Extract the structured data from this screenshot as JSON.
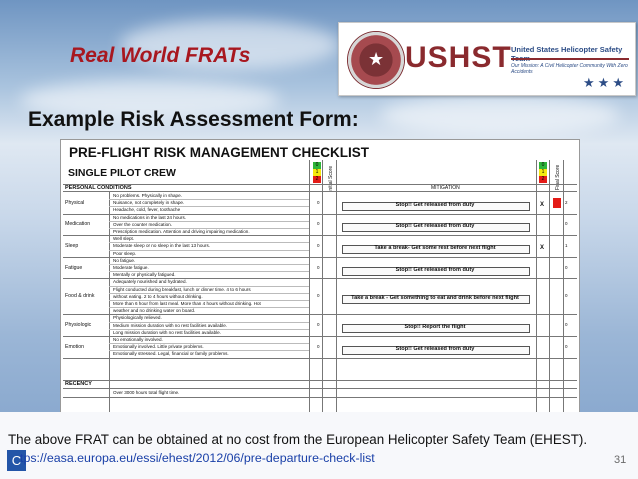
{
  "slide": {
    "title": "Real World FRATs",
    "heading": "Example Risk Assessment Form:",
    "page_number": "31",
    "corner_badge": "C"
  },
  "logo": {
    "wordmark": "USHST",
    "name": "United States Helicopter Safety Team",
    "tagline": "Our Mission: A Civil Helicopter Community With Zero Accidents",
    "seal_text": "USHST United States Helicopter Safety Team"
  },
  "form": {
    "title": "PRE-FLIGHT RISK MANAGEMENT CHECKLIST",
    "crew_label": "SINGLE PILOT CREW",
    "initial_score_label": "Initial Score",
    "final_score_label": "Final Score",
    "mitigation_header": "MITIGATION",
    "score_key": [
      "0",
      "1",
      "2"
    ],
    "section_personal": "PERSONAL CONDITIONS",
    "section_recency": "RECENCY",
    "categories": [
      {
        "name": "Physical",
        "conditions": [
          "No problems. Physically in shape.",
          "Nuisance, not completely in shape.",
          "Headache, cold, fever, toothache"
        ],
        "score": "0",
        "mitigation": "Stop!! Get released from duty",
        "mark": "X",
        "final": "2"
      },
      {
        "name": "Medication",
        "conditions": [
          "No medications in the last 24 hours.",
          "Over the counter medication.",
          "Prescription medication. Attention and driving impairing medication."
        ],
        "score": "0",
        "mitigation": "Stop!! Get released from duty",
        "mark": "",
        "final": "0"
      },
      {
        "name": "Sleep",
        "conditions": [
          "Well slept.",
          "Moderate sleep or no sleep in the last 13 hours.",
          "Poor sleep."
        ],
        "score": "0",
        "mitigation": "Take a break- Get some rest before next flight",
        "mark": "X",
        "final": "1"
      },
      {
        "name": "Fatigue",
        "conditions": [
          "No fatigue.",
          "Moderate fatigue.",
          "Mentally or physically fatigued."
        ],
        "score": "0",
        "mitigation": "Stop!! Get released from duty",
        "mark": "",
        "final": "0"
      },
      {
        "name": "Food & drink",
        "conditions": [
          "Adequately nourished and hydrated.",
          "Flight conducted during breakfast, lunch or dinner time. 4 to 6 hours",
          "without eating. 2 to 4 hours without drinking.",
          "More than 6 hour from last meal. More than 4 hours without drinking. Hot",
          "weather and no drinking water on board."
        ],
        "score": "0",
        "mitigation": "Take a break - Get something to eat and drink before next flight",
        "mark": "",
        "final": "0"
      },
      {
        "name": "Physiologic",
        "conditions": [
          "Physiologically relieved.",
          "Medium mission duration with no rest facilities available.",
          "Long mission duration with no rest facilities available."
        ],
        "score": "0",
        "mitigation": "Stop!! Report the flight",
        "mark": "",
        "final": "0"
      },
      {
        "name": "Emotion",
        "conditions": [
          "No emotionally involved.",
          "Emotionally involved. Little private problems.",
          "Emotionally stressed. Legal, financial or family problems."
        ],
        "score": "0",
        "mitigation": "Stop!! Get released from duty",
        "mark": "",
        "final": "0"
      }
    ],
    "recency_condition": "Over 3000 hours total flight time."
  },
  "footer": {
    "text": "The above FRAT can be obtained at no cost from the European Helicopter Safety Team (EHEST).",
    "link": "tps://easa.europa.eu/essi/ehest/2012/06/pre-departure-check-list"
  },
  "colors": {
    "title_red": "#a8171f",
    "link_blue": "#1a40a8",
    "score_green": "#2fb53a",
    "score_yellow": "#f4e80e",
    "score_red": "#e41b17"
  }
}
